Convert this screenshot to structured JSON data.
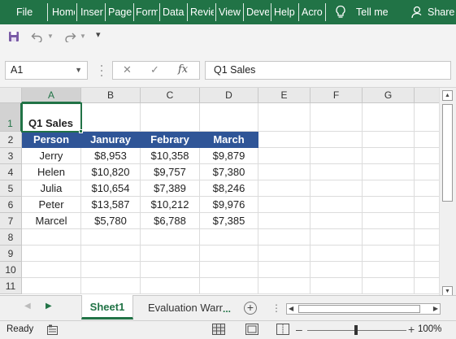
{
  "ribbon": {
    "tabs": [
      "File",
      "Home",
      "Insert",
      "Page Layout",
      "Formulas",
      "Data",
      "Review",
      "View",
      "Developer",
      "Help",
      "Acrobat"
    ],
    "tell_me": "Tell me",
    "share": "Share",
    "accent": "#217346"
  },
  "formula_bar": {
    "name_box": "A1",
    "fx_label": "fx",
    "content": "Q1 Sales"
  },
  "grid": {
    "columns": [
      "A",
      "B",
      "C",
      "D",
      "E",
      "F",
      "G"
    ],
    "rows": [
      "1",
      "2",
      "3",
      "4",
      "5",
      "6",
      "7",
      "8",
      "9",
      "10",
      "11"
    ],
    "title": "Q1 Sales",
    "headers": [
      "Person",
      "Januray",
      "Febrary",
      "March"
    ],
    "data": [
      [
        "Jerry",
        "$8,953",
        "$10,358",
        "$9,879"
      ],
      [
        "Helen",
        "$10,820",
        "$9,757",
        "$7,380"
      ],
      [
        "Julia",
        "$10,654",
        "$7,389",
        "$8,246"
      ],
      [
        "Peter",
        "$13,587",
        "$10,212",
        "$9,976"
      ],
      [
        "Marcel",
        "$5,780",
        "$6,788",
        "$7,385"
      ]
    ],
    "header_fill": "#2f5597"
  },
  "sheets": {
    "active": "Sheet1",
    "other": "Evaluation Warning",
    "more": "..."
  },
  "status": {
    "ready": "Ready",
    "zoom": "100%"
  }
}
